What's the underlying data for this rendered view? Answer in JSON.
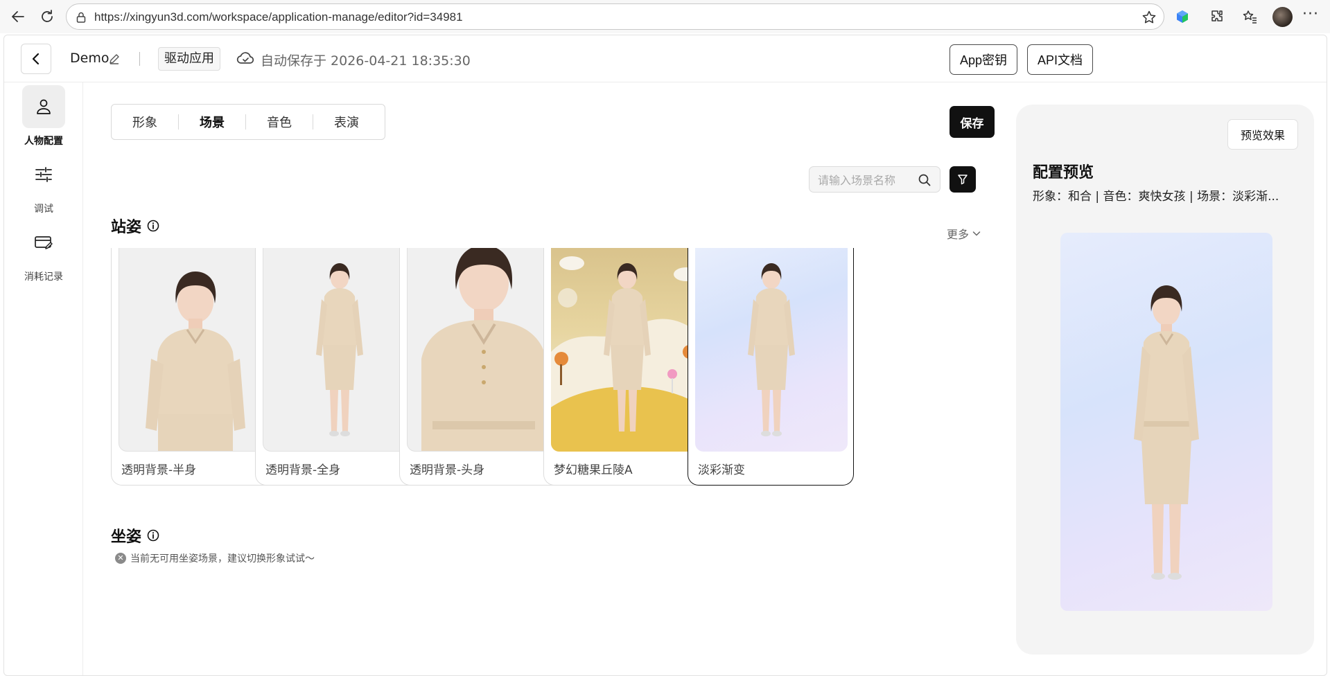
{
  "browser": {
    "url": "https://xingyun3d.com/workspace/application-manage/editor?id=34981"
  },
  "header": {
    "app_name": "Demo",
    "app_type": "驱动应用",
    "autosave": "自动保存于 2026-04-21 18:35:30",
    "app_key_button": "App密钥",
    "api_docs_button": "API文档"
  },
  "sidebar": {
    "items": [
      {
        "label": "人物配置",
        "icon": "person-icon",
        "active": true
      },
      {
        "label": "调试",
        "icon": "sliders-icon",
        "active": false
      },
      {
        "label": "消耗记录",
        "icon": "card-edit-icon",
        "active": false
      }
    ]
  },
  "tabs": [
    {
      "label": "形象",
      "active": false
    },
    {
      "label": "场景",
      "active": true
    },
    {
      "label": "音色",
      "active": false
    },
    {
      "label": "表演",
      "active": false
    }
  ],
  "save_button": "保存",
  "search": {
    "placeholder": "请输入场景名称"
  },
  "standing": {
    "title": "站姿",
    "more": "更多",
    "cards": [
      {
        "label": "透明背景-半身",
        "selected": false
      },
      {
        "label": "透明背景-全身",
        "selected": false
      },
      {
        "label": "透明背景-头身",
        "selected": false
      },
      {
        "label": "梦幻糖果丘陵A",
        "selected": false
      },
      {
        "label": "淡彩渐变",
        "selected": true
      }
    ]
  },
  "sitting": {
    "title": "坐姿",
    "notice": "当前无可用坐姿场景，建议切换形象试试～"
  },
  "preview": {
    "effect_button": "预览效果",
    "title": "配置预览",
    "summary": "形象：和合 | 音色：爽快女孩 | 场景：淡彩渐..."
  },
  "colors": {
    "accent": "#111111",
    "selected_border": "#111111",
    "panel_bg": "#f4f4f4"
  }
}
